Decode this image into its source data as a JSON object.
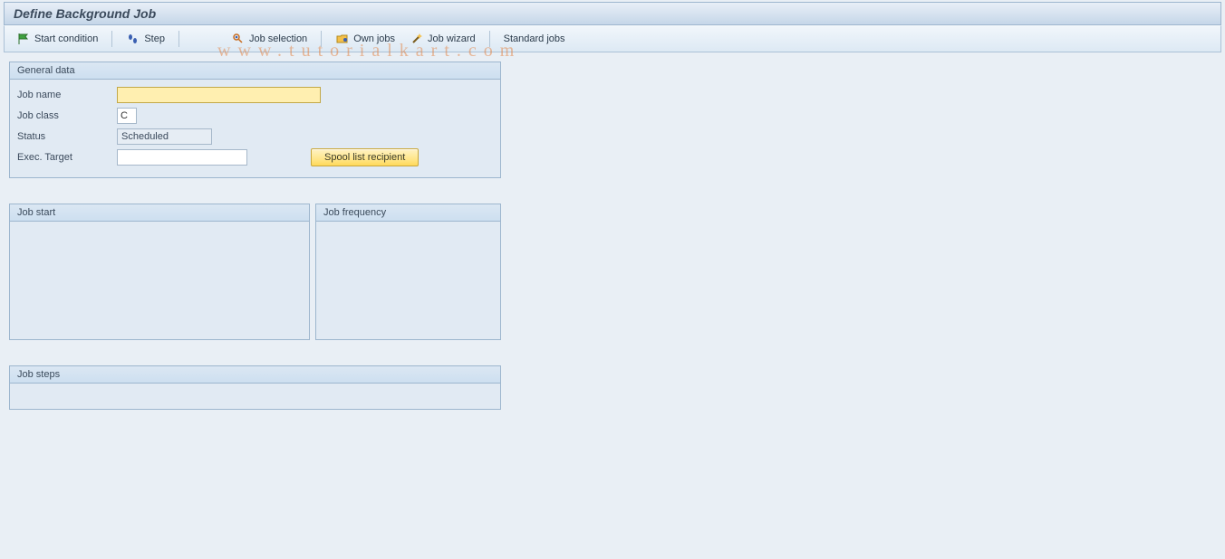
{
  "title": "Define Background Job",
  "toolbar": {
    "start_condition": "Start condition",
    "step": "Step",
    "job_selection": "Job selection",
    "own_jobs": "Own jobs",
    "job_wizard": "Job wizard",
    "standard_jobs": "Standard jobs"
  },
  "general_data": {
    "title": "General data",
    "job_name_label": "Job name",
    "job_name_value": "",
    "job_class_label": "Job class",
    "job_class_value": "C",
    "status_label": "Status",
    "status_value": "Scheduled",
    "exec_target_label": "Exec. Target",
    "exec_target_value": "",
    "spool_button": "Spool list recipient"
  },
  "panels": {
    "job_start": "Job start",
    "job_frequency": "Job frequency",
    "job_steps": "Job steps"
  },
  "watermark": "www.tutorialkart.com"
}
